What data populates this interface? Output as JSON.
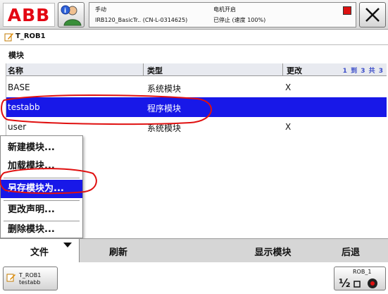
{
  "topbar": {
    "logo": "ABB",
    "status_mode": "手动",
    "status_controller": "IRB120_BasicTr.. (CN-L-0314625)",
    "status_motor": "电机开启",
    "status_state": "已停止 (速度 100%)"
  },
  "tab": {
    "title": "T_ROB1"
  },
  "section": {
    "label": "模块"
  },
  "table": {
    "headers": {
      "name": "名称",
      "type": "类型",
      "changed": "更改",
      "range": "1 到 3 共 3"
    },
    "rows": [
      {
        "name": "BASE",
        "type": "系统模块",
        "changed": "X"
      },
      {
        "name": "testabb",
        "type": "程序模块",
        "changed": ""
      },
      {
        "name": "user",
        "type": "系统模块",
        "changed": "X"
      }
    ]
  },
  "menu": {
    "items": [
      {
        "label": "新建模块..."
      },
      {
        "label": "加载模块..."
      },
      {
        "label": "另存模块为..."
      },
      {
        "label": "更改声明..."
      },
      {
        "label": "删除模块..."
      }
    ]
  },
  "commands": {
    "file": "文件",
    "refresh": "刷新",
    "show_module": "显示模块",
    "back": "后退"
  },
  "taskbar": {
    "task_line1": "T_ROB1",
    "task_line2": "testabb",
    "quickset_label": "ROB_1"
  },
  "colors": {
    "selection": "#1818e8",
    "abb_red": "#e30613",
    "annotation_red": "#e01010"
  }
}
